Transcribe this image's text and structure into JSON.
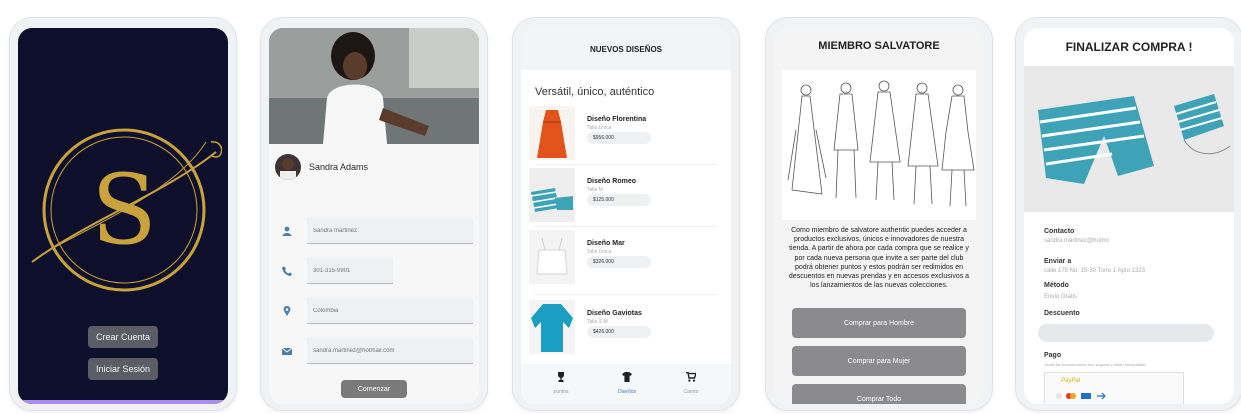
{
  "colors": {
    "dark_bg": "#0e0f2a",
    "gold": "#c9a23c",
    "button_grey": "#5b5c66",
    "icon_blue": "#4a7fa6",
    "accent_purple": "#a98ef0"
  },
  "screen1": {
    "logo_letter": "S",
    "create_account_label": "Crear Cuenta",
    "login_label": "Iniciar Sesión"
  },
  "screen2": {
    "profile_name": "Sandra Adams",
    "fields": [
      {
        "icon": "person-icon",
        "placeholder": "Sandra martinez"
      },
      {
        "icon": "phone-icon",
        "placeholder": "301-315-9901"
      },
      {
        "icon": "location-pin-icon",
        "placeholder": "Colombia"
      },
      {
        "icon": "email-icon",
        "placeholder": "sandra.martinez@hotmail.com"
      }
    ],
    "submit_label": "Comenzar"
  },
  "screen3": {
    "title": "NUEVOS DISEÑOS",
    "tagline": "Versátil, único, auténtico",
    "products": [
      {
        "name": "Diseño Florentina",
        "size": "Talla Única",
        "price": "$956.000"
      },
      {
        "name": "Diseño Romeo",
        "size": "Talla M",
        "price": "$125.000"
      },
      {
        "name": "Diseño Mar",
        "size": "Talla Única",
        "price": "$326.000"
      },
      {
        "name": "Diseño Gaviotas",
        "size": "Talla S-M",
        "price": "$426.000"
      }
    ],
    "nav": [
      {
        "icon": "trophy-icon",
        "label": "puntos"
      },
      {
        "icon": "shirt-icon",
        "label": "Diseños"
      },
      {
        "icon": "cart-icon",
        "label": "Carrito"
      }
    ]
  },
  "screen4": {
    "title": "MIEMBRO SALVATORE",
    "description": "Como miembro de salvatore authentic puedes acceder a productos exclusivos, únicos e innovadores de nuestra tienda. A partir de ahora por cada compra que se realice y por cada nueva persona que invite a ser parte del club podrá obtener puntos y estos podrán ser redimidos en descuentos en nuevas prendas y en accesos exclusivos a los lanzamientos de las nuevas colecciones.",
    "buttons": [
      "Comprar para Hombre",
      "Comprar para Mujer",
      "Comprar Todo"
    ]
  },
  "screen5": {
    "title": "FINALIZAR COMPRA !",
    "contact_label": "Contacto",
    "contact_value": "sandra.martinez@hotmc",
    "ship_label": "Enviar a",
    "ship_value": "calle 175 No. 15-30 Torre 1 Apto 1323",
    "method_label": "Método",
    "method_value": "Envío Gratis",
    "discount_label": "Descuento",
    "payment_label": "Pago",
    "payment_note": "Todas las transacciones son seguras y están encriptadas.",
    "paypal_label": "PayPal"
  }
}
